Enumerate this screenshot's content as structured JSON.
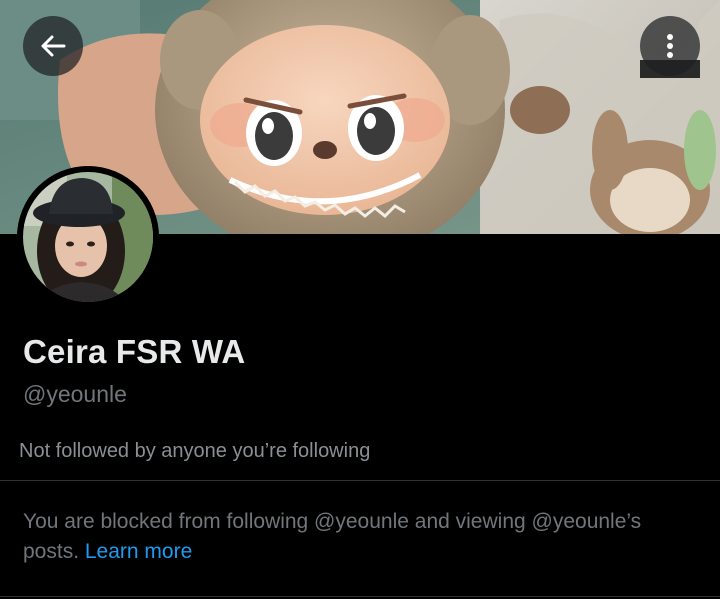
{
  "profile": {
    "display_name": "Ceira FSR WA",
    "handle": "@yeounle",
    "followers_note": "Not followed by anyone you’re following"
  },
  "blocked": {
    "message": "You are blocked from following @yeounle and viewing @yeounle’s posts.",
    "link_label": "Learn more"
  },
  "icons": {
    "back": "arrow-left-icon",
    "more": "more-vertical-icon"
  },
  "colors": {
    "background": "#000000",
    "primary_text": "#e7e9ea",
    "secondary_text": "#71767b",
    "link": "#1d9bf0",
    "divider": "#2f3336"
  }
}
